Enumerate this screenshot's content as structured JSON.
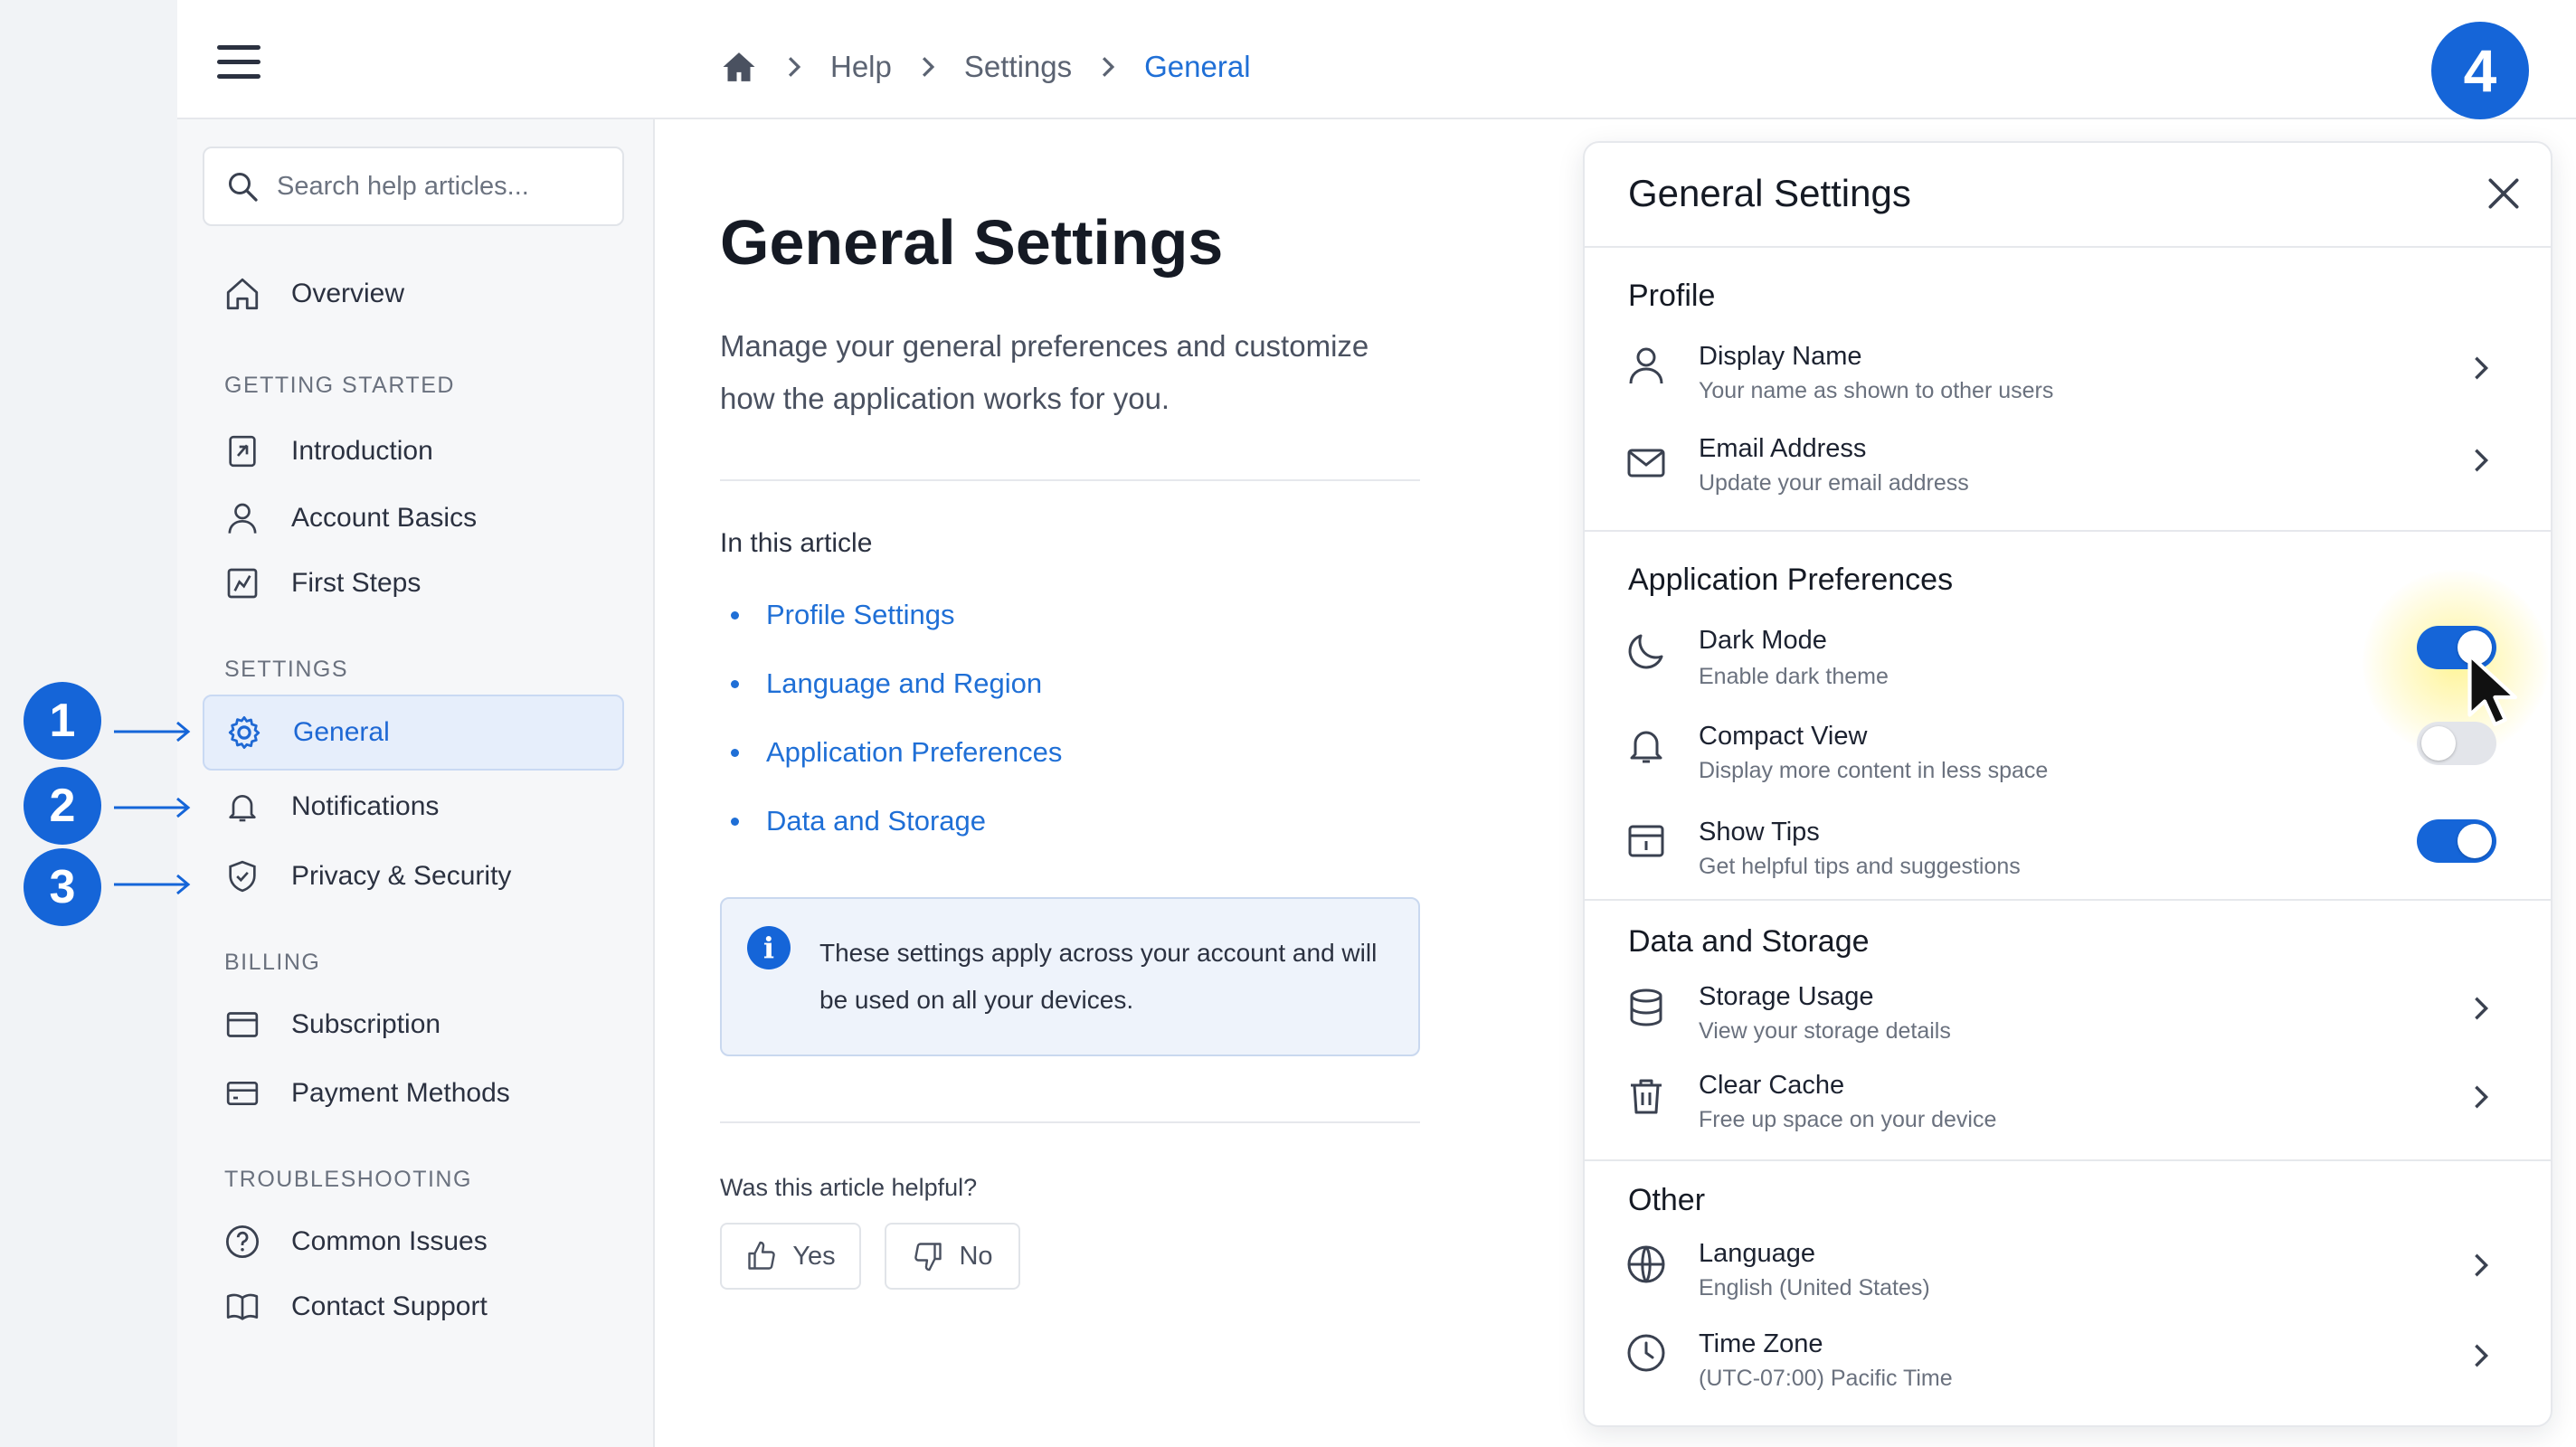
{
  "breadcrumb": {
    "items": [
      "Help",
      "Settings"
    ],
    "current": "General"
  },
  "step_badges": [
    "1",
    "2",
    "3",
    "4"
  ],
  "search": {
    "placeholder": "Search help articles..."
  },
  "sidebar": {
    "overview": "Overview",
    "sections": [
      {
        "title": "GETTING STARTED",
        "items": [
          "Introduction",
          "Account Basics",
          "First Steps"
        ]
      },
      {
        "title": "SETTINGS",
        "items": [
          "General",
          "Notifications",
          "Privacy & Security"
        ]
      },
      {
        "title": "BILLING",
        "items": [
          "Subscription",
          "Payment Methods"
        ]
      },
      {
        "title": "TROUBLESHOOTING",
        "items": [
          "Common Issues",
          "Contact Support"
        ]
      }
    ],
    "active": "General"
  },
  "article": {
    "title": "General Settings",
    "intro": "Manage your general preferences and customize how the application works for you.",
    "toc_heading": "In this article",
    "toc": [
      "Profile Settings",
      "Language and Region",
      "Application Preferences",
      "Data and Storage"
    ],
    "info": "These settings apply across your account and will be used on all your devices.",
    "helpful_question": "Was this article helpful?",
    "yes": "Yes",
    "no": "No"
  },
  "panel": {
    "title": "General Settings",
    "sections": [
      {
        "title": "Profile",
        "rows": [
          {
            "label": "Display Name",
            "sub": "Your name as shown to other users",
            "icon": "user-icon"
          },
          {
            "label": "Email Address",
            "sub": "Update your email address",
            "icon": "mail-icon"
          }
        ]
      },
      {
        "title": "Application Preferences",
        "rows": [
          {
            "label": "Dark Mode",
            "sub": "Enable dark theme",
            "icon": "moon-icon",
            "toggle": true
          },
          {
            "label": "Compact View",
            "sub": "Display more content in less space",
            "icon": "bell-icon",
            "toggle": false
          },
          {
            "label": "Show Tips",
            "sub": "Get helpful tips and suggestions",
            "icon": "tips-icon",
            "toggle": true
          }
        ]
      },
      {
        "title": "Data and Storage",
        "rows": [
          {
            "label": "Storage Usage",
            "sub": "View your storage details",
            "icon": "database-icon"
          },
          {
            "label": "Clear Cache",
            "sub": "Free up space on your device",
            "icon": "trash-icon"
          }
        ]
      },
      {
        "title": "Other",
        "rows": [
          {
            "label": "Language",
            "sub": "English (United States)",
            "icon": "globe-icon"
          },
          {
            "label": "Time Zone",
            "sub": "(UTC-07:00) Pacific Time",
            "icon": "clock-icon"
          }
        ]
      }
    ]
  },
  "colors": {
    "accent": "#1565d8",
    "link": "#1f6fd6",
    "active_bg": "#e6eefb",
    "highlight": "#fff3a0"
  }
}
